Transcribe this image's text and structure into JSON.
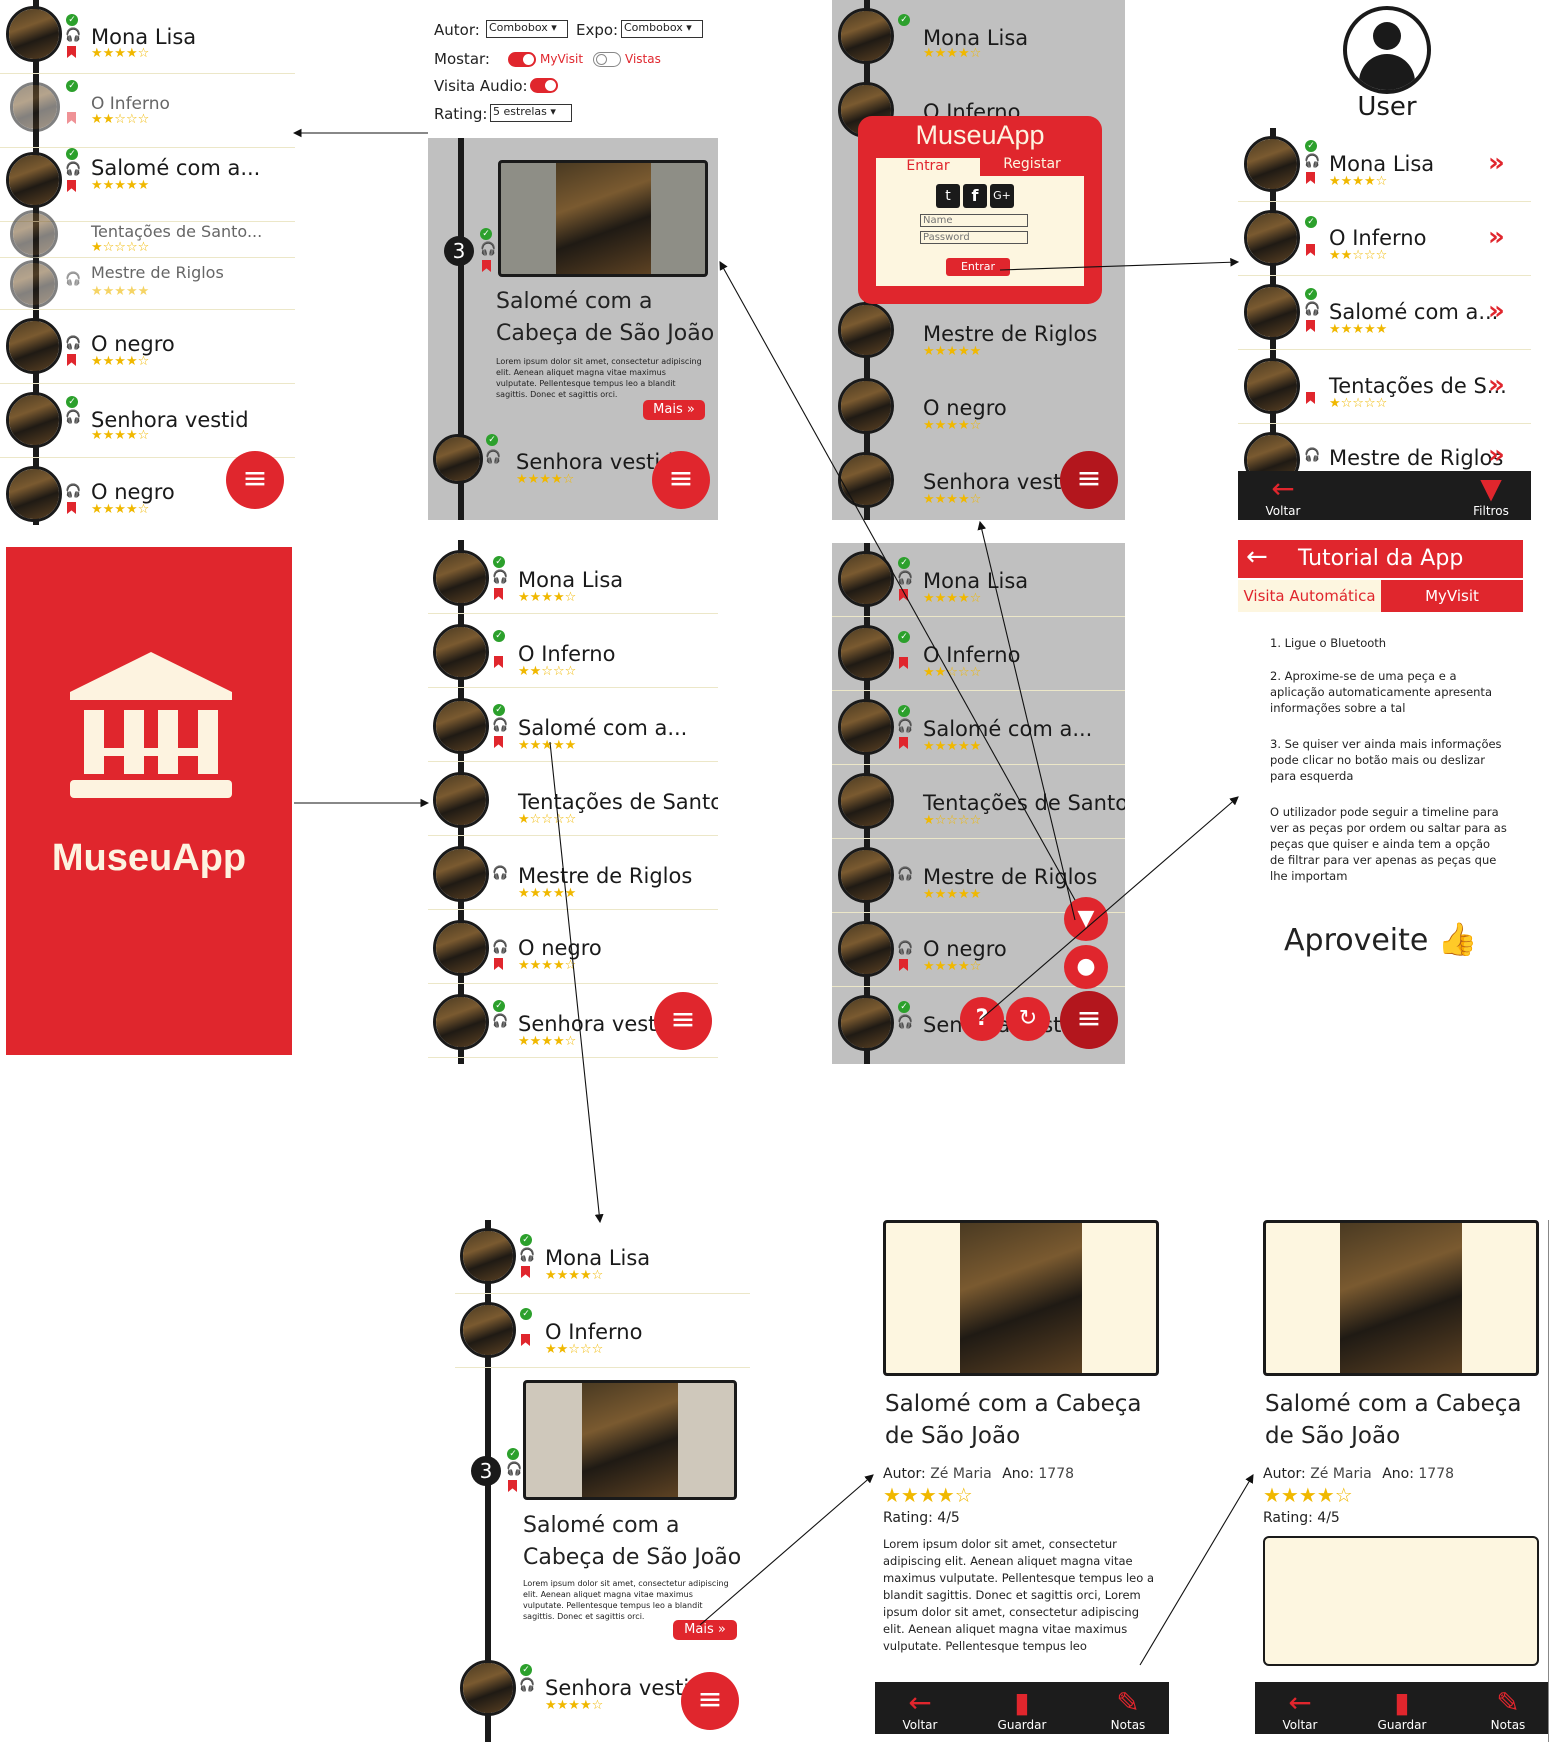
{
  "artworks": [
    {
      "title": "Mona Lisa",
      "stars": "★★★★☆"
    },
    {
      "title": "O Inferno",
      "stars": "★★☆☆☆"
    },
    {
      "title": "Salomé com a...",
      "stars": "★★★★★"
    },
    {
      "title": "Tentações de Santo...",
      "stars": "★☆☆☆☆"
    },
    {
      "title": "Mestre de Riglos",
      "stars": "★★★★★"
    },
    {
      "title": "O negro",
      "stars": "★★★★☆"
    },
    {
      "title": "Senhora vestid",
      "stars": "★★★★☆"
    }
  ],
  "screen1": {
    "titles": [
      "Mona Lisa",
      "O Inferno",
      "Salomé com a...",
      "Tentações de Santo...",
      "Mestre de Riglos",
      "O negro",
      "Senhora vestid",
      "O negro"
    ],
    "stars": [
      "★★★★☆",
      "★★☆☆☆",
      "★★★★★",
      "★☆☆☆☆",
      "★★★★★",
      "★★★★☆",
      "★★★★☆",
      "★★★★☆"
    ]
  },
  "filters": {
    "autor_label": "Autor:",
    "autor_value": "Combobox",
    "expo_label": "Expo:",
    "expo_value": "Combobox",
    "mostrar_label": "Mostar:",
    "myvisit": "MyVisit",
    "vistas": "Vistas",
    "audio_label": "Visita Audio:",
    "rating_label": "Rating:",
    "rating_value": "5 estrelas"
  },
  "expanded": {
    "number": "3",
    "title_line1": "Salomé com a",
    "title_line2": "Cabeça de São João",
    "lorem": "Lorem ipsum dolor sit amet, consectetur adipiscing elit. Aenean aliquet magna vitae maximus vulputate. Pellentesque tempus leo a blandit sagittis. Donec et sagittis orci.",
    "mais": "Mais",
    "next_title": "Senhora vestida",
    "next_stars": "★★★★☆"
  },
  "login": {
    "app_name": "MuseuApp",
    "tab_entrar": "Entrar",
    "tab_registar": "Registar",
    "name_placeholder": "Name",
    "password_placeholder": "Password",
    "submit": "Entrar"
  },
  "user_screen": {
    "label": "User",
    "titles": [
      "Mona Lisa",
      "O Inferno",
      "Salomé com a...",
      "Tentações de S...",
      "Mestre de Riglos"
    ],
    "stars": [
      "★★★★☆",
      "★★☆☆☆",
      "★★★★★",
      "★☆☆☆☆",
      "★★★★★"
    ],
    "nav_back": "Voltar",
    "nav_filters": "Filtros"
  },
  "splash": {
    "app_name": "MuseuApp"
  },
  "tutorial": {
    "title": "Tutorial da App",
    "tab1": "Visita Automática",
    "tab2": "MyVisit",
    "step1": "1. Ligue o Bluetooth",
    "step2": "2. Aproxime-se de uma peça e a aplicação automaticamente apresenta informações sobre a tal",
    "step3": "3. Se quiser ver ainda mais informações pode clicar no botão mais ou deslizar para esquerda",
    "step4": "O utilizador pode seguir a timeline para ver as peças por ordem ou saltar para as peças que quiser e ainda tem a opção de filtrar para ver apenas as peças que lhe importam",
    "outro": "Aproveite"
  },
  "detail": {
    "title_line1": "Salomé com a Cabeça",
    "title_line2": "de São João",
    "autor_label": "Autor:",
    "autor": "Zé Maria",
    "ano_label": "Ano:",
    "ano": "1778",
    "stars": "★★★★☆",
    "rating": "Rating: 4/5",
    "lorem": "Lorem ipsum dolor sit amet, consectetur adipiscing elit. Aenean aliquet magna vitae maximus vulputate. Pellentesque tempus leo a blandit sagittis. Donec et sagittis orci, Lorem ipsum dolor sit amet, consectetur adipiscing elit. Aenean aliquet magna vitae maximus vulputate. Pellentesque tempus leo",
    "nav_back": "Voltar",
    "nav_save": "Guardar",
    "nav_notes": "Notas"
  },
  "colors": {
    "accent": "#e0262d",
    "dark": "#1c1c1c",
    "overlay": "#c0c0c0",
    "star": "#f0b800",
    "check": "#2ca02c"
  }
}
